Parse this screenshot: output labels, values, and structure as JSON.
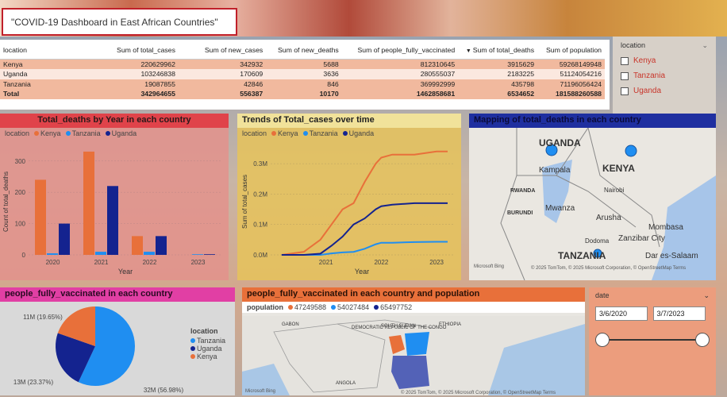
{
  "title": "\"COVID-19 Dashboard in East African Countries\"",
  "table": {
    "headers": [
      "location",
      "Sum of total_cases",
      "Sum of new_cases",
      "Sum of new_deaths",
      "Sum of people_fully_vaccinated",
      "Sum of total_deaths",
      "Sum of population"
    ],
    "rows": [
      [
        "Kenya",
        "220629962",
        "342932",
        "5688",
        "812310645",
        "3915629",
        "59268149948"
      ],
      [
        "Uganda",
        "103246838",
        "170609",
        "3636",
        "280555037",
        "2183225",
        "51124054216"
      ],
      [
        "Tanzania",
        "19087855",
        "42846",
        "846",
        "369992999",
        "435798",
        "71196056424"
      ],
      [
        "Total",
        "342964655",
        "556387",
        "10170",
        "1462858681",
        "6534652",
        "181588260588"
      ]
    ]
  },
  "location_slicer": {
    "label": "location",
    "options": [
      "Kenya",
      "Tanzania",
      "Uganda"
    ]
  },
  "colors": {
    "kenya": "#e8703a",
    "tanzania": "#1f8ef1",
    "uganda": "#14238f"
  },
  "bar_chart": {
    "title": "Total_deaths by Year in each country",
    "legend_label": "location",
    "legend": [
      "Kenya",
      "Tanzania",
      "Uganda"
    ],
    "xlabel": "Year",
    "ylabel": "Count of total_deaths",
    "yticks": [
      "0",
      "100",
      "200",
      "300"
    ],
    "xticks": [
      "2020",
      "2021",
      "2022",
      "2023"
    ]
  },
  "line_chart": {
    "title": "Trends of Total_cases over time",
    "legend_label": "location",
    "legend": [
      "Kenya",
      "Tanzania",
      "Uganda"
    ],
    "xlabel": "Year",
    "ylabel": "Sum of total_cases",
    "yticks": [
      "0.0M",
      "0.1M",
      "0.2M",
      "0.3M"
    ],
    "xticks": [
      "2021",
      "2022",
      "2023"
    ]
  },
  "map1": {
    "title": "Mapping of total_deaths in each country",
    "labels": [
      "UGANDA",
      "KENYA",
      "TANZANIA",
      "Kampala",
      "Nairobi",
      "Mwanza",
      "Arusha",
      "Mombasa",
      "Zanzibar City",
      "Dar es-Salaam",
      "Dodoma",
      "RWANDA",
      "BURUNDI"
    ],
    "credit": "© 2025 TomTom, © 2025 Microsoft Corporation, © OpenStreetMap Terms",
    "brand": "Microsoft Bing"
  },
  "pie_chart": {
    "title": "people_fully_vaccinated in each country",
    "legend_label": "location",
    "legend": [
      "Tanzania",
      "Uganda",
      "Kenya"
    ],
    "labels": [
      "11M (19.65%)",
      "13M (23.37%)",
      "32M (56.98%)"
    ]
  },
  "map2": {
    "title": "people_fully_vaccinated in each country and population",
    "legend_label": "population",
    "legend": [
      "47249588",
      "54027484",
      "65497752"
    ],
    "labels": [
      "DEMOCRATIC REPUBLIC OF THE CONGO",
      "SOUTH SUDAN",
      "ANGOLA",
      "GABON",
      "ETHIOPIA"
    ],
    "credit": "© 2025 TomTom, © 2025 Microsoft Corporation, © OpenStreetMap Terms",
    "brand": "Microsoft Bing"
  },
  "date_slicer": {
    "label": "date",
    "start": "3/6/2020",
    "end": "3/7/2023"
  },
  "chart_data": [
    {
      "type": "bar",
      "title": "Total_deaths by Year in each country",
      "categories": [
        "2020",
        "2021",
        "2022",
        "2023"
      ],
      "series": [
        {
          "name": "Kenya",
          "values": [
            240,
            330,
            60,
            0
          ]
        },
        {
          "name": "Tanzania",
          "values": [
            5,
            10,
            10,
            2
          ]
        },
        {
          "name": "Uganda",
          "values": [
            100,
            220,
            60,
            2
          ]
        }
      ],
      "xlabel": "Year",
      "ylabel": "Count of total_deaths",
      "ylim": [
        0,
        340
      ]
    },
    {
      "type": "line",
      "title": "Trends of Total_cases over time",
      "x": [
        2020.2,
        2020.6,
        2020.9,
        2021.1,
        2021.3,
        2021.5,
        2021.7,
        2021.9,
        2022.0,
        2022.2,
        2022.6,
        2023.0,
        2023.2
      ],
      "series": [
        {
          "name": "Kenya",
          "values": [
            0.0,
            0.01,
            0.05,
            0.1,
            0.15,
            0.17,
            0.24,
            0.3,
            0.32,
            0.33,
            0.33,
            0.34,
            0.34
          ]
        },
        {
          "name": "Tanzania",
          "values": [
            0.0,
            0.0,
            0.0,
            0.005,
            0.008,
            0.01,
            0.02,
            0.035,
            0.04,
            0.04,
            0.042,
            0.043,
            0.043
          ]
        },
        {
          "name": "Uganda",
          "values": [
            0.0,
            0.0,
            0.004,
            0.03,
            0.06,
            0.1,
            0.12,
            0.15,
            0.16,
            0.165,
            0.17,
            0.17,
            0.17
          ]
        }
      ],
      "xlabel": "Year",
      "ylabel": "Sum of total_cases",
      "ylim": [
        0,
        0.35
      ]
    },
    {
      "type": "pie",
      "title": "people_fully_vaccinated in each country",
      "categories": [
        "Tanzania",
        "Uganda",
        "Kenya"
      ],
      "values": [
        56.98,
        23.37,
        19.65
      ]
    }
  ]
}
